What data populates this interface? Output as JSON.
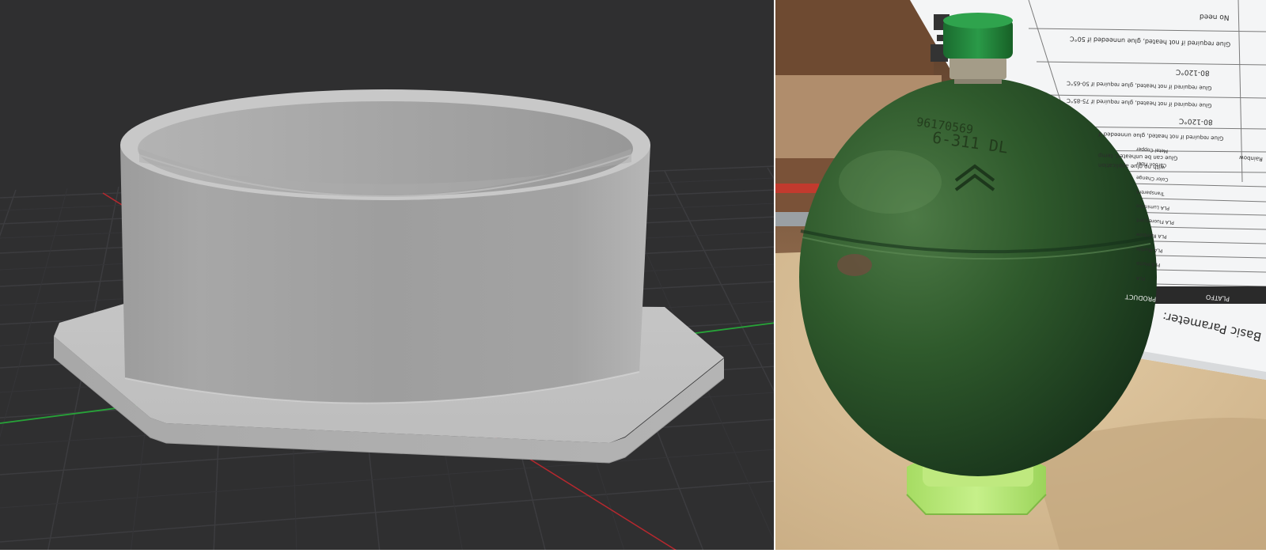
{
  "left_render": {
    "description_label": "",
    "colors": {
      "background": "#2f2f30",
      "grid": "#3b3b3d",
      "axis_x": "#b7282e",
      "axis_y": "#27a338",
      "model": "#a9a9a9"
    }
  },
  "right_photo": {
    "sphere_part_number": "96170569",
    "sphere_code": "6-311 DL",
    "datasheet": {
      "heading": "Basic Parameter:",
      "header_product": "PRODUCT",
      "header_platform": "PLATFO",
      "rows": [
        "No need",
        "Glue required if not heated, glue unneeded if 50°C",
        "80-120°C",
        "Glue required if not heated, glue required if 50-65°C",
        "Glue required if not heated, glue required if 75-85°C",
        "80-120°C",
        "Glue required if not heated, glue unneeded if",
        "Glue can be unheated, temp",
        "with no glue application"
      ],
      "products": [
        "PLA",
        "PLA Matte",
        "PLA Marble",
        "PLA Rainbow",
        "PLA Fluorescent",
        "PLA Luminous",
        "Transparent",
        "Color Change",
        "Carbon Fiber",
        "Metal Copper",
        "Rainbow"
      ]
    },
    "colors": {
      "sphere": "#2d5a2a",
      "cap": "#1f7a35",
      "mount": "#b8e872",
      "table": "#dcc59f",
      "paper": "#f4f5f6"
    }
  }
}
